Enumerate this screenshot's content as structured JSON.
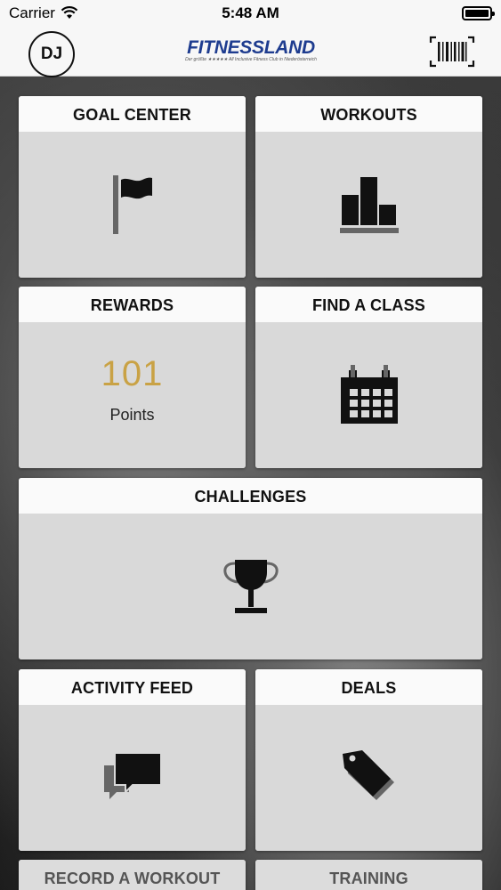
{
  "status_bar": {
    "carrier": "Carrier",
    "time": "5:48 AM"
  },
  "header": {
    "avatar_initials": "DJ",
    "logo_text": "FITNESSLAND",
    "logo_tagline": "Der größte ★★★★★ All Inclusive Fitness Club in Niederösterreich",
    "barcode_icon": "barcode-icon"
  },
  "tiles": {
    "goal_center": {
      "title": "GOAL CENTER",
      "icon": "flag-icon"
    },
    "workouts": {
      "title": "WORKOUTS",
      "icon": "bar-chart-icon"
    },
    "rewards": {
      "title": "REWARDS",
      "points_value": "101",
      "points_label": "Points"
    },
    "find_a_class": {
      "title": "FIND A CLASS",
      "icon": "calendar-icon"
    },
    "challenges": {
      "title": "CHALLENGES",
      "icon": "trophy-icon"
    },
    "activity_feed": {
      "title": "ACTIVITY FEED",
      "icon": "chat-bubbles-icon"
    },
    "deals": {
      "title": "DEALS",
      "icon": "tag-icon"
    },
    "record_a_workout": {
      "title": "RECORD A WORKOUT"
    },
    "training": {
      "title": "TRAINING"
    }
  },
  "colors": {
    "points_accent": "#c9a245",
    "logo_blue": "#1e3c8f"
  }
}
